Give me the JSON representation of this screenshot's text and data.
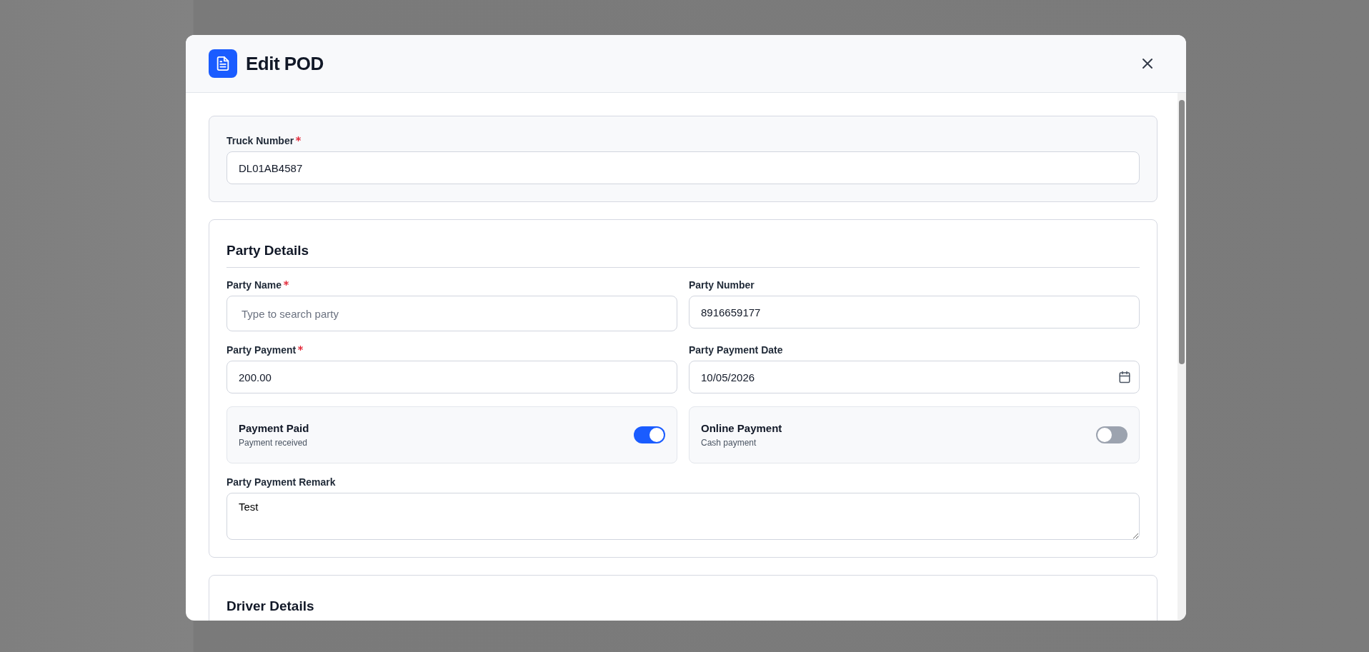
{
  "dialog": {
    "title": "Edit POD"
  },
  "sections": [
    {
      "kind": "highlight",
      "fields": [
        {
          "kind": "text",
          "label": "Truck Number",
          "required": true,
          "value": "DL01AB4587"
        }
      ]
    },
    {
      "kind": "group",
      "title": "Party Details",
      "fields": [
        {
          "kind": "text",
          "label": "Party Name",
          "required": true,
          "placeholder": "Type to search party"
        },
        {
          "kind": "text",
          "label": "Party Number",
          "required": false,
          "value": "8916659177"
        },
        {
          "kind": "text",
          "label": "Party Payment",
          "required": true,
          "value": "200.00"
        },
        {
          "kind": "date",
          "label": "Party Payment Date",
          "required": false,
          "value": "10/05/2026"
        },
        {
          "kind": "toggle",
          "label": "Payment Paid",
          "description": "Payment received",
          "on": true
        },
        {
          "kind": "toggle",
          "label": "Online Payment",
          "description": "Cash payment",
          "on": false
        },
        {
          "kind": "textarea",
          "label": "Party Payment Remark",
          "required": false,
          "value": "Test"
        }
      ]
    },
    {
      "kind": "group",
      "title": "Driver Details"
    }
  ]
}
